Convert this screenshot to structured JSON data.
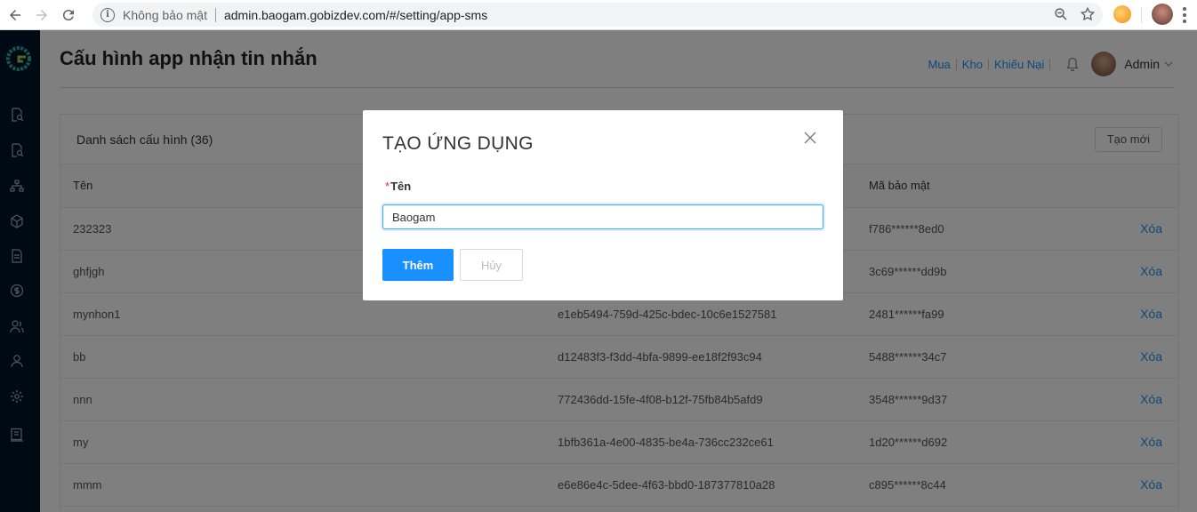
{
  "browser": {
    "security_text": "Không bảo mật",
    "url": "admin.baogam.gobizdev.com/#/setting/app-sms"
  },
  "sidebar": {
    "icons": [
      "document-search-icon",
      "document-search-icon",
      "sitemap-icon",
      "cube-icon",
      "file-icon",
      "money-icon",
      "users-icon",
      "user-icon",
      "gear-icon",
      "report-icon"
    ]
  },
  "header": {
    "title": "Cấu hình app nhận tin nhắn",
    "links": [
      "Mua",
      "Kho",
      "Khiếu Nại"
    ],
    "user_name": "Admin"
  },
  "list": {
    "title": "Danh sách cấu hình (36)",
    "create_button": "Tạo mới",
    "columns": [
      "Tên",
      "",
      "Mã bảo mật",
      ""
    ],
    "rows": [
      {
        "name": "232323",
        "key": "",
        "secret": "f786******8ed0",
        "action": "Xóa"
      },
      {
        "name": "ghfjgh",
        "key": "",
        "secret": "3c69******dd9b",
        "action": "Xóa"
      },
      {
        "name": "mynhon1",
        "key": "e1eb5494-759d-425c-bdec-10c6e1527581",
        "secret": "2481******fa99",
        "action": "Xóa"
      },
      {
        "name": "bb",
        "key": "d12483f3-f3dd-4bfa-9899-ee18f2f93c94",
        "secret": "5488******34c7",
        "action": "Xóa"
      },
      {
        "name": "nnn",
        "key": "772436dd-15fe-4f08-b12f-75fb84b5afd9",
        "secret": "3548******9d37",
        "action": "Xóa"
      },
      {
        "name": "my",
        "key": "1bfb361a-4e00-4835-be4a-736cc232ce61",
        "secret": "1d20******d692",
        "action": "Xóa"
      },
      {
        "name": "mmm",
        "key": "e6e86e4c-5dee-4f63-bbd0-187377810a28",
        "secret": "c895******8c44",
        "action": "Xóa"
      }
    ]
  },
  "modal": {
    "title": "TẠO ỨNG DỤNG",
    "required_mark": "*",
    "field_label": "Tên",
    "field_value": "Baogam",
    "submit_label": "Thêm",
    "cancel_label": "Hủy"
  },
  "colors": {
    "primary": "#1890ff",
    "sidebar_bg": "#001529",
    "required": "#f5222d"
  }
}
